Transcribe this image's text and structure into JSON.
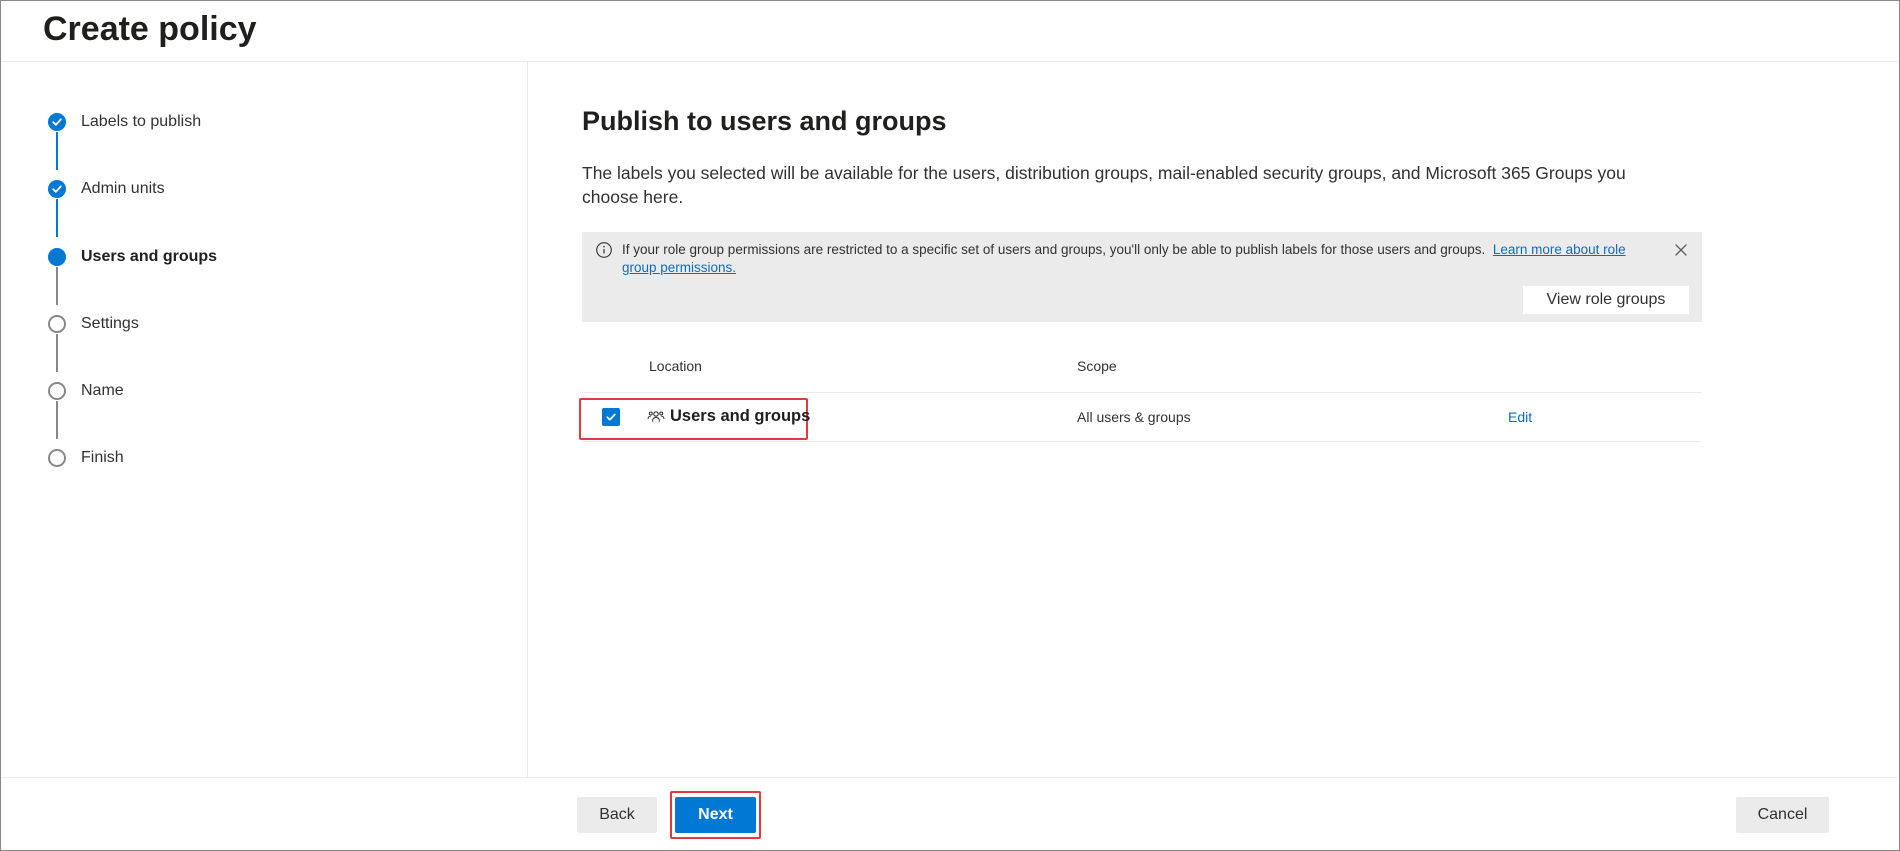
{
  "header": {
    "title": "Create policy"
  },
  "steps": [
    {
      "label": "Labels to publish",
      "state": "done"
    },
    {
      "label": "Admin units",
      "state": "done"
    },
    {
      "label": "Users and groups",
      "state": "current"
    },
    {
      "label": "Settings",
      "state": "todo"
    },
    {
      "label": "Name",
      "state": "todo"
    },
    {
      "label": "Finish",
      "state": "todo"
    }
  ],
  "main": {
    "heading": "Publish to users and groups",
    "description": "The labels you selected will be available for the users, distribution groups, mail-enabled security groups, and Microsoft 365 Groups you choose here.",
    "info_bar": {
      "icon": "info-icon",
      "text": "If your role group permissions are restricted to a specific set of users and groups, you'll only be able to publish labels for those users and groups.",
      "link_text": "Learn more about role group permissions.",
      "button_label": "View role groups",
      "close_icon": "close-icon"
    },
    "table": {
      "columns": [
        "Location",
        "Scope"
      ],
      "rows": [
        {
          "checked": true,
          "icon": "people-icon",
          "location": "Users and groups",
          "scope": "All users & groups",
          "action": "Edit"
        }
      ]
    }
  },
  "footer": {
    "back_label": "Back",
    "next_label": "Next",
    "cancel_label": "Cancel"
  },
  "colors": {
    "accent": "#0078d4",
    "highlight": "#e3393f",
    "info_bar_bg": "#ebebeb",
    "link": "#0f6cbd"
  }
}
